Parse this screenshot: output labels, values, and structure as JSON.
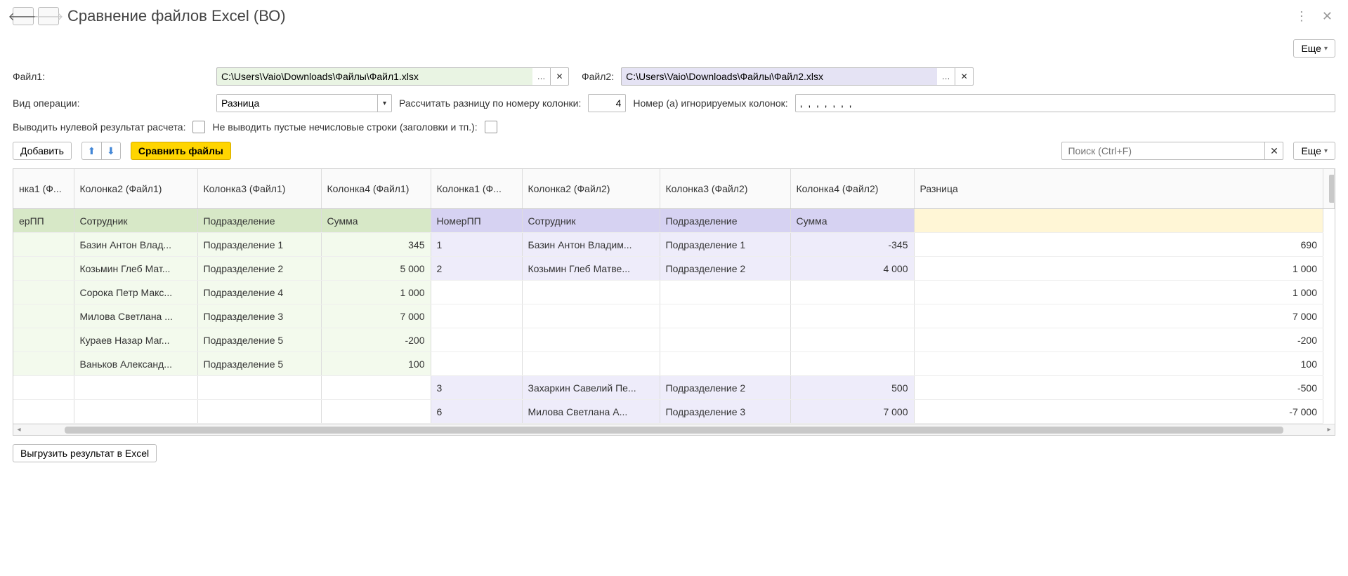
{
  "header": {
    "title": "Сравнение файлов Excel (ВО)",
    "more_label": "Еще"
  },
  "form": {
    "file1_label": "Файл1:",
    "file1_value": "C:\\Users\\Vaio\\Downloads\\Файлы\\Файл1.xlsx",
    "file2_label": "Файл2:",
    "file2_value": "C:\\Users\\Vaio\\Downloads\\Файлы\\Файл2.xlsx",
    "op_label": "Вид операции:",
    "op_value": "Разница",
    "calc_label": "Рассчитать разницу по номеру колонки:",
    "calc_value": "4",
    "ignore_label": "Номер (а) игнорируемых колонок:",
    "ignore_value": ",  ,  ,  ,  ,  ,  ,",
    "zero_label": "Выводить нулевой результат расчета:",
    "empty_label": "Не выводить пустые нечисловые строки (заголовки и тп.):"
  },
  "toolbar": {
    "add_label": "Добавить",
    "compare_label": "Сравнить файлы",
    "search_placeholder": "Поиск (Ctrl+F)",
    "more_label": "Еще"
  },
  "table": {
    "headers": [
      "нка1 (Ф...",
      "Колонка2 (Файл1)",
      "Колонка3 (Файл1)",
      "Колонка4 (Файл1)",
      "Колонка1 (Ф...",
      "Колонка2 (Файл2)",
      "Колонка3 (Файл2)",
      "Колонка4 (Файл2)",
      "Разница"
    ],
    "subheader_f1": [
      "ерПП",
      "Сотрудник",
      "Подразделение",
      "Сумма"
    ],
    "subheader_f2": [
      "НомерПП",
      "Сотрудник",
      "Подразделение",
      "Сумма"
    ],
    "rows": [
      {
        "c1": "",
        "c2": "Базин Антон Влад...",
        "c3": "Подразделение 1",
        "c4": "345",
        "c5": "1",
        "c6": "Базин Антон Владим...",
        "c7": "Подразделение 1",
        "c8": "-345",
        "c9": "690",
        "type": "both"
      },
      {
        "c1": "",
        "c2": "Козьмин Глеб Мат...",
        "c3": "Подразделение 2",
        "c4": "5 000",
        "c5": "2",
        "c6": "Козьмин Глеб Матве...",
        "c7": "Подразделение 2",
        "c8": "4 000",
        "c9": "1 000",
        "type": "both"
      },
      {
        "c1": "",
        "c2": "Сорока Петр Макс...",
        "c3": "Подразделение 4",
        "c4": "1 000",
        "c5": "",
        "c6": "",
        "c7": "",
        "c8": "",
        "c9": "1 000",
        "type": "f1"
      },
      {
        "c1": "",
        "c2": "Милова Светлана ...",
        "c3": "Подразделение 3",
        "c4": "7 000",
        "c5": "",
        "c6": "",
        "c7": "",
        "c8": "",
        "c9": "7 000",
        "type": "f1"
      },
      {
        "c1": "",
        "c2": "Кураев Назар Маг...",
        "c3": "Подразделение 5",
        "c4": "-200",
        "c5": "",
        "c6": "",
        "c7": "",
        "c8": "",
        "c9": "-200",
        "type": "f1"
      },
      {
        "c1": "",
        "c2": "Ваньков Александ...",
        "c3": "Подразделение 5",
        "c4": "100",
        "c5": "",
        "c6": "",
        "c7": "",
        "c8": "",
        "c9": "100",
        "type": "f1"
      },
      {
        "c1": "",
        "c2": "",
        "c3": "",
        "c4": "",
        "c5": "3",
        "c6": "Захаркин Савелий Пе...",
        "c7": "Подразделение 2",
        "c8": "500",
        "c9": "-500",
        "type": "f2"
      },
      {
        "c1": "",
        "c2": "",
        "c3": "",
        "c4": "",
        "c5": "6",
        "c6": "Милова Светлана А...",
        "c7": "Подразделение 3",
        "c8": "7 000",
        "c9": "-7 000",
        "type": "f2"
      }
    ]
  },
  "footer": {
    "export_label": "Выгрузить результат в Excel"
  }
}
